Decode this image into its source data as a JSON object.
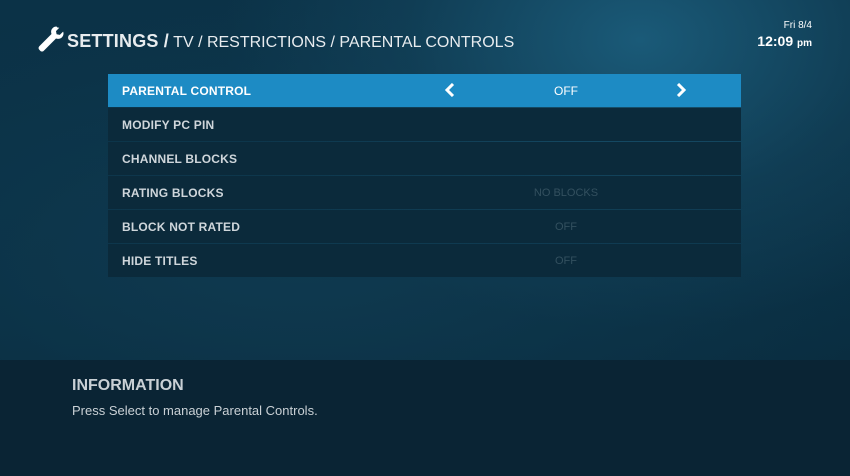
{
  "header": {
    "title": "SETTINGS /",
    "path": "TV / RESTRICTIONS / PARENTAL CONTROLS",
    "icon": "wrench-icon"
  },
  "clock": {
    "day": "Fri 8/4",
    "time": "12:09",
    "ampm": "pm"
  },
  "menu": {
    "items": [
      {
        "label": "PARENTAL CONTROL",
        "value": "OFF"
      },
      {
        "label": "MODIFY PC PIN",
        "value": ""
      },
      {
        "label": "CHANNEL BLOCKS",
        "value": ""
      },
      {
        "label": "RATING BLOCKS",
        "value": "NO BLOCKS"
      },
      {
        "label": "BLOCK NOT RATED",
        "value": "OFF"
      },
      {
        "label": "HIDE TITLES",
        "value": "OFF"
      }
    ]
  },
  "info": {
    "heading": "INFORMATION",
    "text": "Press Select to manage Parental Controls."
  },
  "colors": {
    "selected_row": "#1d8bc4",
    "row_bg": "#0b2a3b",
    "background": "#0a2f43"
  }
}
